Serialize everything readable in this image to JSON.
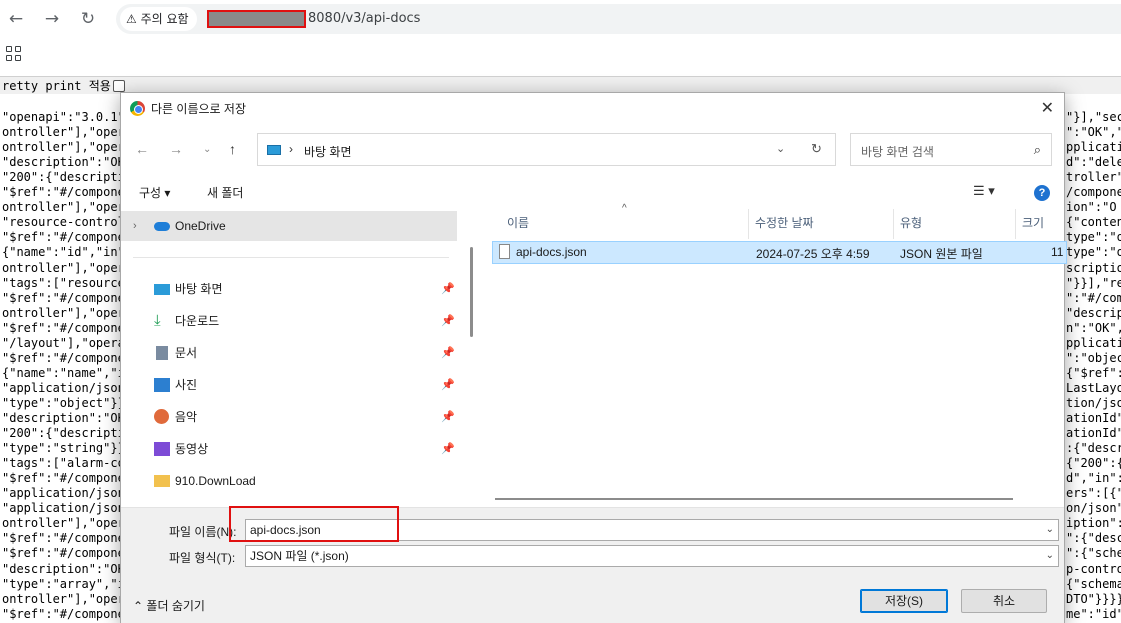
{
  "browser": {
    "back_icon": "←",
    "forward_icon": "→",
    "reload_icon": "↻",
    "security_label": "주의 요함",
    "url_rest": "8080/v3/api-docs"
  },
  "page": {
    "pretty_print_label": "retty print 적용",
    "json_left": [
      "\"openapi\":\"3.0.1\"",
      "ontroller\"],\"oper",
      "ontroller\"],\"oper",
      "\"description\":\"OK",
      "\"200\":{\"descripti",
      "\"$ref\":\"#/compone",
      "ontroller\"],\"oper",
      "\"resource-control",
      "\"$ref\":\"#/compone",
      "{\"name\":\"id\",\"in\"",
      "ontroller\"],\"oper",
      "\"tags\":[\"resource",
      "\"$ref\":\"#/compone",
      "ontroller\"],\"oper",
      "\"$ref\":\"#/compone",
      "\"/layout\"],\"opera",
      "\"$ref\":\"#/compone",
      "{\"name\":\"name\",\"i",
      "\"application/json",
      "\"type\":\"object\"}}",
      "\"description\":\"OK",
      "\"200\":{\"descripti",
      "\"type\":\"string\"}}",
      "\"tags\":[\"alarm-co",
      "\"$ref\":\"#/compone",
      "\"application/json",
      "\"application/json",
      "ontroller\"],\"oper",
      "\"$ref\":\"#/compone",
      "\"$ref\":\"#/compone",
      "\"description\":\"OK",
      "\"type\":\"array\",\"i",
      "ontroller\"],\"oper",
      "\"$ref\":\"#/compone"
    ],
    "json_right": [
      "\"}],\"sec",
      "\":\"OK\",\"",
      "pplicatio",
      "d\":\"dele",
      "troller\"",
      "/compone",
      "ion\":\"O",
      "{\"conten",
      "type\":\"obje",
      "type\":\"ob",
      "scriptio",
      "\"}}],\"re",
      "\":\"#/com",
      "\"descrip",
      "n\":\"OK\",",
      "pplicati",
      "\":\"objec",
      "{\"$ref\":",
      "LastLayo",
      "tion/jso",
      "ationId\"",
      "ationId\"",
      ":{\"descr",
      "{\"200\":{",
      "d\",\"in\":",
      "ers\":[{\"",
      "on/json\":",
      "iption\":",
      "\":{\"desc",
      "\":{\"sche",
      "p-contro",
      "{\"schema",
      "DTO\"}}}}",
      "me\":\"id\""
    ]
  },
  "dialog": {
    "title": "다른 이름으로 저장",
    "close_icon": "✕",
    "path_label": "바탕 화면",
    "search_placeholder": "바탕 화면 검색",
    "organize_label": "구성 ▾",
    "new_folder_label": "새 폴더",
    "help_label": "?",
    "nav_items": [
      {
        "label": "OneDrive"
      },
      {
        "label": "바탕 화면"
      },
      {
        "label": "다운로드"
      },
      {
        "label": "문서"
      },
      {
        "label": "사진"
      },
      {
        "label": "음악"
      },
      {
        "label": "동영상"
      },
      {
        "label": "910.DownLoad"
      }
    ],
    "columns": {
      "name": "이름",
      "date": "수정한 날짜",
      "type": "유형",
      "size": "크기"
    },
    "file": {
      "name": "api-docs.json",
      "date": "2024-07-25 오후 4:59",
      "type": "JSON 원본 파일",
      "size": "11"
    },
    "filename_label": "파일 이름(N):",
    "filename_value": "api-docs.json",
    "filetype_label": "파일 형식(T):",
    "filetype_value": "JSON 파일 (*.json)",
    "hide_folders_label": "폴더 숨기기",
    "save_label": "저장(S)",
    "cancel_label": "취소"
  }
}
